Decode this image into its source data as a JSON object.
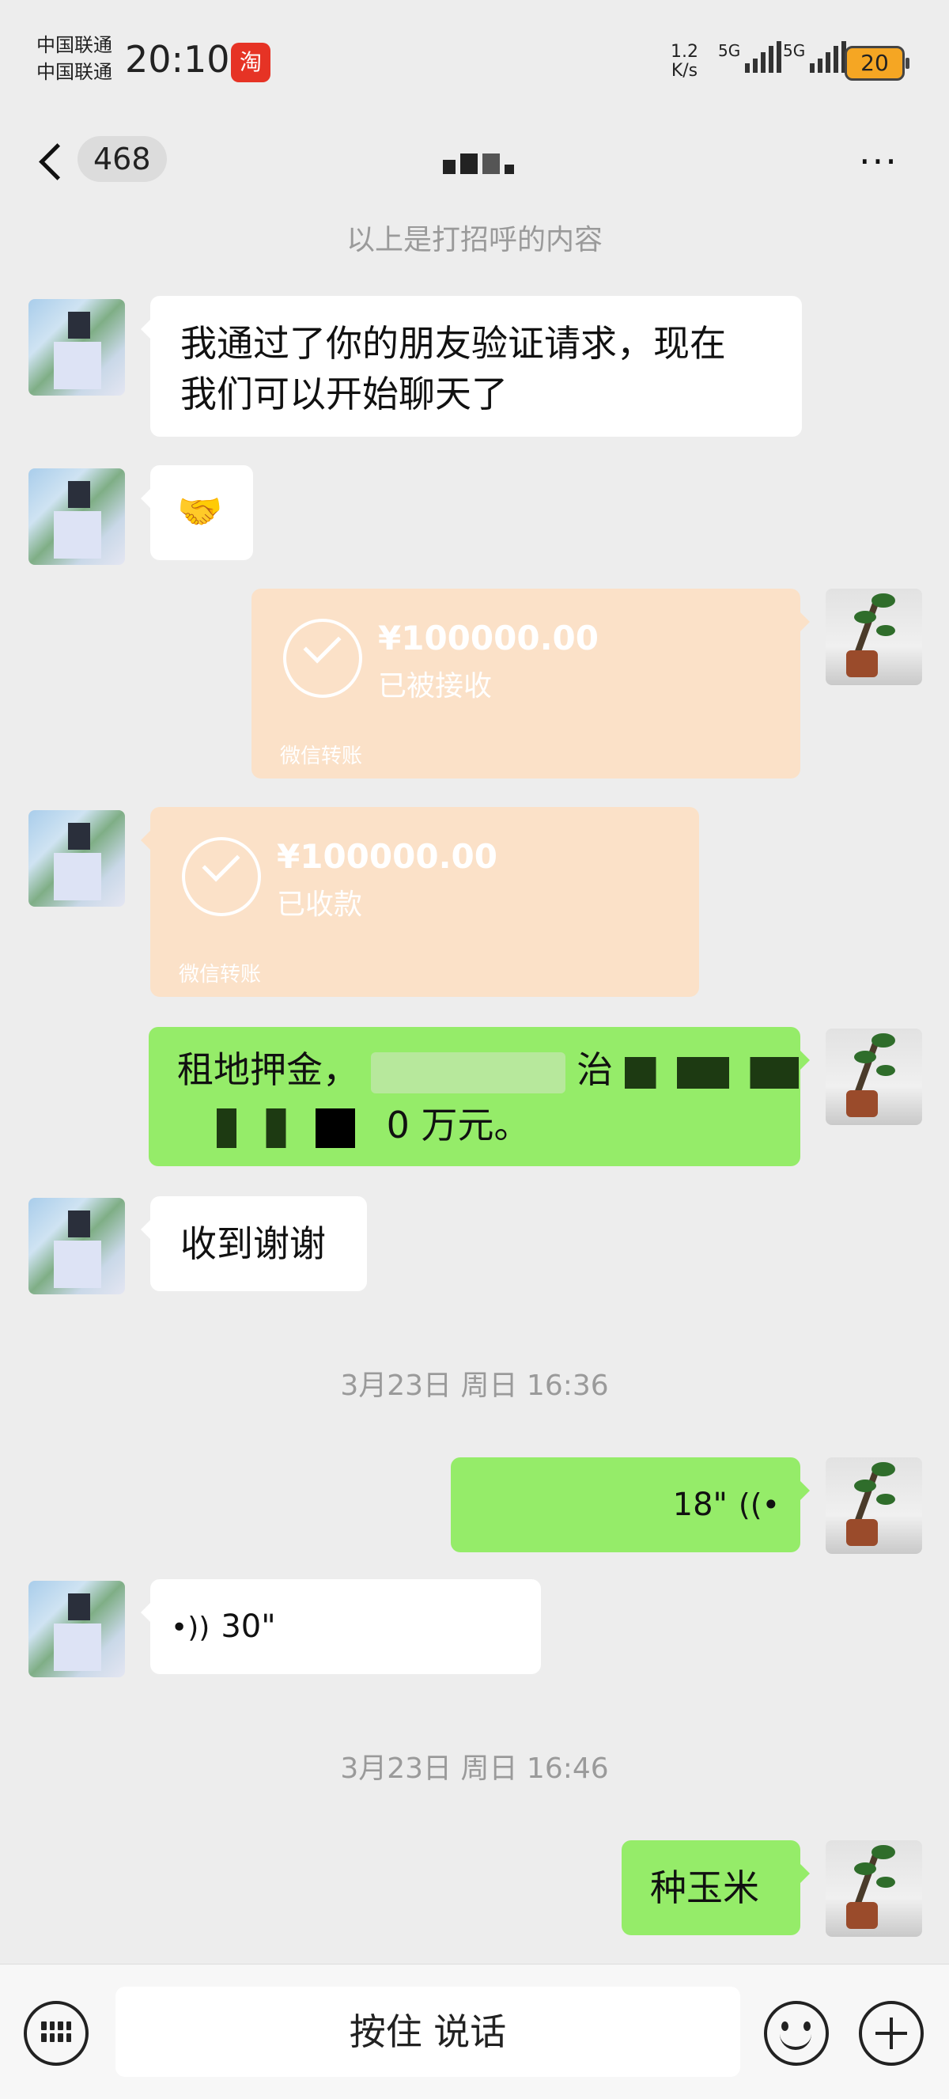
{
  "status_bar": {
    "carrier_1": "中国联通",
    "carrier_2": "中国联通",
    "time": "20:10",
    "taobao_badge": "淘",
    "net_speed_value": "1.2",
    "net_speed_unit": "K/s",
    "signal_1_label": "5G",
    "signal_2_label": "5G",
    "battery": "20"
  },
  "header": {
    "unread_count": "468",
    "more_label": "···"
  },
  "system_notice": "以上是打招呼的内容",
  "messages": {
    "m1_text_line1": "我通过了你的朋友验证请求，现在",
    "m1_text_line2": "我们可以开始聊天了",
    "m2_emoji": "🤝",
    "t1_amount": "¥100000.00",
    "t1_status": "已被接收",
    "t1_footer": "微信转账",
    "t2_amount": "¥100000.00",
    "t2_status": "已收款",
    "t2_footer": "微信转账",
    "m5_prefix": "租地押金，",
    "m5_mid": "治",
    "m5_suffix": "0 万元。",
    "m6_text": "收到谢谢",
    "time_1": "3月23日 周日 16:36",
    "v1_duration": "18\"",
    "v2_duration": "30\"",
    "time_2": "3月23日 周日 16:46",
    "m9_text": "种玉米"
  },
  "input_bar": {
    "hold_to_talk": "按住 说话"
  },
  "colors": {
    "background": "#ededed",
    "sent_bubble": "#95ec69",
    "received_bubble": "#ffffff",
    "transfer_card": "#fbe1c8"
  }
}
